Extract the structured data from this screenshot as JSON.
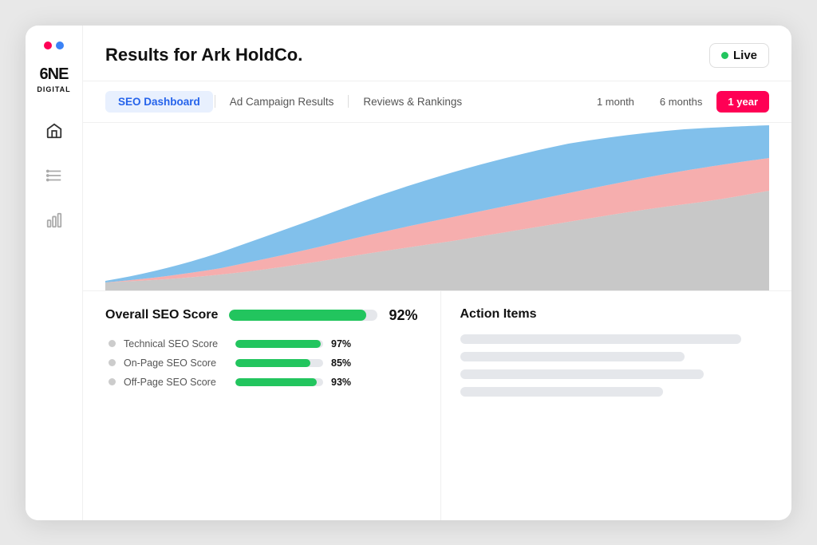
{
  "window": {
    "title": "Results for Ark HoldCo."
  },
  "sidebar": {
    "logo_line1": "6NE",
    "logo_line2": "DIGITAL",
    "dots": [
      {
        "color": "#ff0055",
        "label": "red-dot"
      },
      {
        "color": "#3b82f6",
        "label": "blue-dot"
      }
    ],
    "nav_items": [
      {
        "name": "home-icon",
        "active": true
      },
      {
        "name": "list-icon",
        "active": false
      },
      {
        "name": "chart-icon",
        "active": false
      }
    ]
  },
  "header": {
    "title": "Results for Ark HoldCo.",
    "live_label": "Live"
  },
  "tabs": [
    {
      "label": "SEO Dashboard",
      "active": true
    },
    {
      "label": "Ad Campaign Results",
      "active": false
    },
    {
      "label": "Reviews & Rankings",
      "active": false
    }
  ],
  "time_filters": [
    {
      "label": "1 month",
      "active": false
    },
    {
      "label": "6 months",
      "active": false
    },
    {
      "label": "1 year",
      "active": true
    }
  ],
  "chart": {
    "colors": {
      "layer1": "#c8c8c8",
      "layer2": "#f4a0a0",
      "layer3": "#6bb5e8"
    }
  },
  "seo_score": {
    "overall_label": "Overall SEO Score",
    "overall_value": "92%",
    "overall_pct": 92,
    "sub_scores": [
      {
        "label": "Technical SEO Score",
        "value": "97%",
        "pct": 97
      },
      {
        "label": "On-Page SEO Score",
        "value": "85%",
        "pct": 85
      },
      {
        "label": "Off-Page SEO Score",
        "value": "93%",
        "pct": 93
      }
    ]
  },
  "action_items": {
    "title": "Action Items",
    "lines": [
      {
        "width": "90%"
      },
      {
        "width": "72%"
      },
      {
        "width": "78%"
      },
      {
        "width": "65%"
      }
    ]
  }
}
